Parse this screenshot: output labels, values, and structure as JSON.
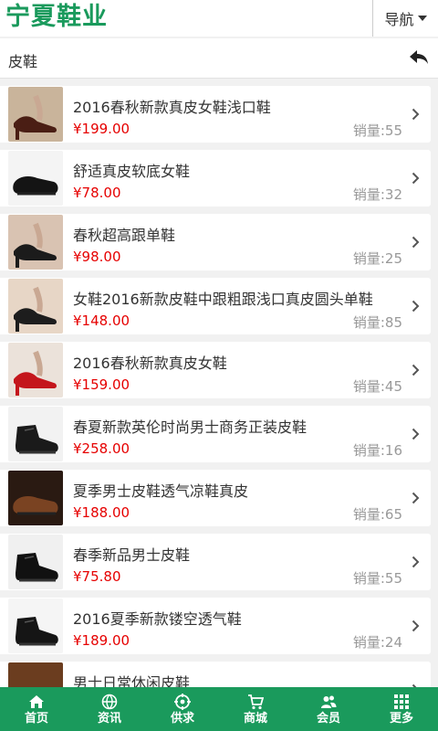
{
  "header": {
    "logo": "宁夏鞋业",
    "nav_label": "导航"
  },
  "subheader": {
    "title": "皮鞋"
  },
  "products": [
    {
      "title": "2016春秋新款真皮女鞋浅口鞋",
      "price": "¥199.00",
      "sales": "销量:55",
      "thumb": {
        "bg": "#c9b49b",
        "shoe": "#4a1e14",
        "kind": "heel"
      }
    },
    {
      "title": "舒适真皮软底女鞋",
      "price": "¥78.00",
      "sales": "销量:32",
      "thumb": {
        "bg": "#f4f4f4",
        "shoe": "#141414",
        "kind": "flat"
      }
    },
    {
      "title": "春秋超高跟单鞋",
      "price": "¥98.00",
      "sales": "销量:25",
      "thumb": {
        "bg": "#d9c3b2",
        "shoe": "#1b1b1b",
        "kind": "heel"
      }
    },
    {
      "title": "女鞋2016新款皮鞋中跟粗跟浅口真皮圆头单鞋",
      "price": "¥148.00",
      "sales": "销量:85",
      "thumb": {
        "bg": "#e7d6c6",
        "shoe": "#1d1d1d",
        "kind": "heel"
      }
    },
    {
      "title": "2016春秋新款真皮女鞋",
      "price": "¥159.00",
      "sales": "销量:45",
      "thumb": {
        "bg": "#ebe2da",
        "shoe": "#c4161c",
        "kind": "heel"
      }
    },
    {
      "title": "春夏新款英伦时尚男士商务正装皮鞋",
      "price": "¥258.00",
      "sales": "销量:16",
      "thumb": {
        "bg": "#f2f2f2",
        "shoe": "#1a1a1a",
        "kind": "boot"
      }
    },
    {
      "title": "夏季男士皮鞋透气凉鞋真皮",
      "price": "¥188.00",
      "sales": "销量:65",
      "thumb": {
        "bg": "#2a1a12",
        "shoe": "#7a4322",
        "kind": "flat"
      }
    },
    {
      "title": "春季新品男士皮鞋",
      "price": "¥75.80",
      "sales": "销量:55",
      "thumb": {
        "bg": "#f0f0f0",
        "shoe": "#111111",
        "kind": "boot"
      }
    },
    {
      "title": "2016夏季新款镂空透气鞋",
      "price": "¥189.00",
      "sales": "销量:24",
      "thumb": {
        "bg": "#f5f5f5",
        "shoe": "#151515",
        "kind": "boot"
      }
    },
    {
      "title": "男士日常休闲皮鞋",
      "price": "",
      "sales": "",
      "thumb": {
        "bg": "#6b3d1f",
        "shoe": "#b06a32",
        "kind": "flat"
      }
    }
  ],
  "tabs": [
    {
      "label": "首页",
      "icon": "home-icon"
    },
    {
      "label": "资讯",
      "icon": "globe-icon"
    },
    {
      "label": "供求",
      "icon": "target-icon"
    },
    {
      "label": "商城",
      "icon": "cart-icon"
    },
    {
      "label": "会员",
      "icon": "users-icon"
    },
    {
      "label": "更多",
      "icon": "grid-icon"
    }
  ],
  "colors": {
    "brand": "#1a9a5c",
    "price": "#e60000",
    "muted": "#999999"
  }
}
